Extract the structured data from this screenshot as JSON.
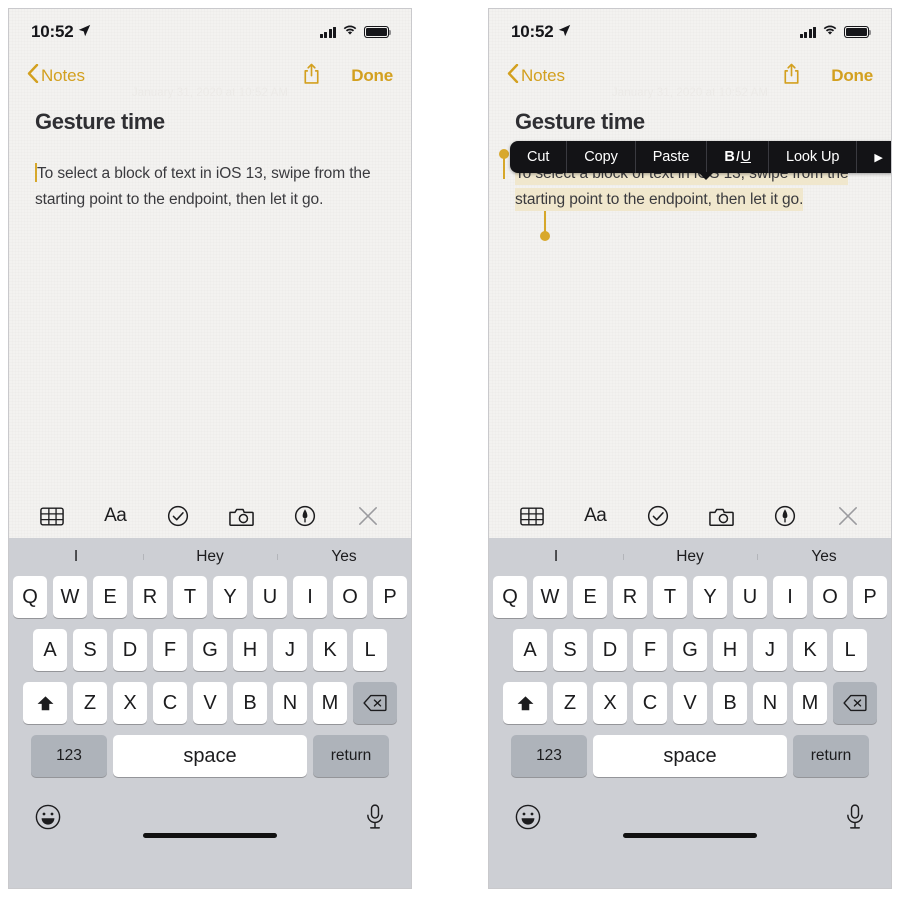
{
  "meta": {
    "app": "Notes",
    "platform": "iOS 13",
    "panels": [
      "text-selected-no-menu",
      "text-selected-with-edit-menu"
    ]
  },
  "status_bar": {
    "time": "10:52",
    "location_icon": "location-arrow-icon",
    "signal_icon": "cellular-signal-icon",
    "signal_bars": 4,
    "wifi_icon": "wifi-icon",
    "battery_icon": "battery-full-icon",
    "battery_level": 100
  },
  "nav_bar": {
    "back_chevron_icon": "chevron-left-icon",
    "back_label": "Notes",
    "share_icon": "share-square-up-arrow-icon",
    "done_label": "Done",
    "accent_color": "#d3a01f"
  },
  "note": {
    "datestamp": "January 31, 2020 at 10:52 AM",
    "title": "Gesture time",
    "body": "To select a block of text in iOS 13, swipe from the starting point to the endpoint, then let it go.",
    "body_lines": [
      "To select a block of text in iOS 13, swipe from",
      "the starting point to the endpoint, then let it",
      "go."
    ],
    "caret_color": "#d6a72a",
    "selection_highlight_color": "#f0e7cd",
    "selection_handle_color": "#d8a82c"
  },
  "edit_menu": {
    "items": [
      {
        "label": "Cut",
        "name": "cut"
      },
      {
        "label": "Copy",
        "name": "copy"
      },
      {
        "label": "Paste",
        "name": "paste"
      },
      {
        "label": "B I U",
        "name": "format-biu"
      },
      {
        "label": "Look Up",
        "name": "look-up"
      },
      {
        "label": "▶",
        "name": "more-arrow"
      }
    ],
    "biu": {
      "bold": "B",
      "italic": "I",
      "underline": "U"
    },
    "background_color": "#131316"
  },
  "format_toolbar": {
    "items": [
      {
        "name": "table-icon",
        "label": "Table"
      },
      {
        "name": "aa-format-icon",
        "label": "Aa"
      },
      {
        "name": "checklist-icon",
        "label": "Checklist"
      },
      {
        "name": "camera-icon",
        "label": "Camera"
      },
      {
        "name": "markup-pen-icon",
        "label": "Markup"
      },
      {
        "name": "close-x-icon",
        "label": "Close"
      }
    ]
  },
  "keyboard": {
    "predictions": [
      "I",
      "Hey",
      "Yes"
    ],
    "row1": [
      "Q",
      "W",
      "E",
      "R",
      "T",
      "Y",
      "U",
      "I",
      "O",
      "P"
    ],
    "row2": [
      "A",
      "S",
      "D",
      "F",
      "G",
      "H",
      "J",
      "K",
      "L"
    ],
    "row3": [
      "Z",
      "X",
      "C",
      "V",
      "B",
      "N",
      "M"
    ],
    "shift_icon": "shift-arrow-up-icon",
    "backspace_icon": "backspace-delete-icon",
    "numeric_label": "123",
    "space_label": "space",
    "return_label": "return",
    "emoji_icon": "emoji-smiley-icon",
    "dictation_icon": "microphone-icon",
    "key_bg": "#ffffff",
    "modifier_bg": "#aeb3ba",
    "keyboard_bg": "#cdcfd4"
  }
}
